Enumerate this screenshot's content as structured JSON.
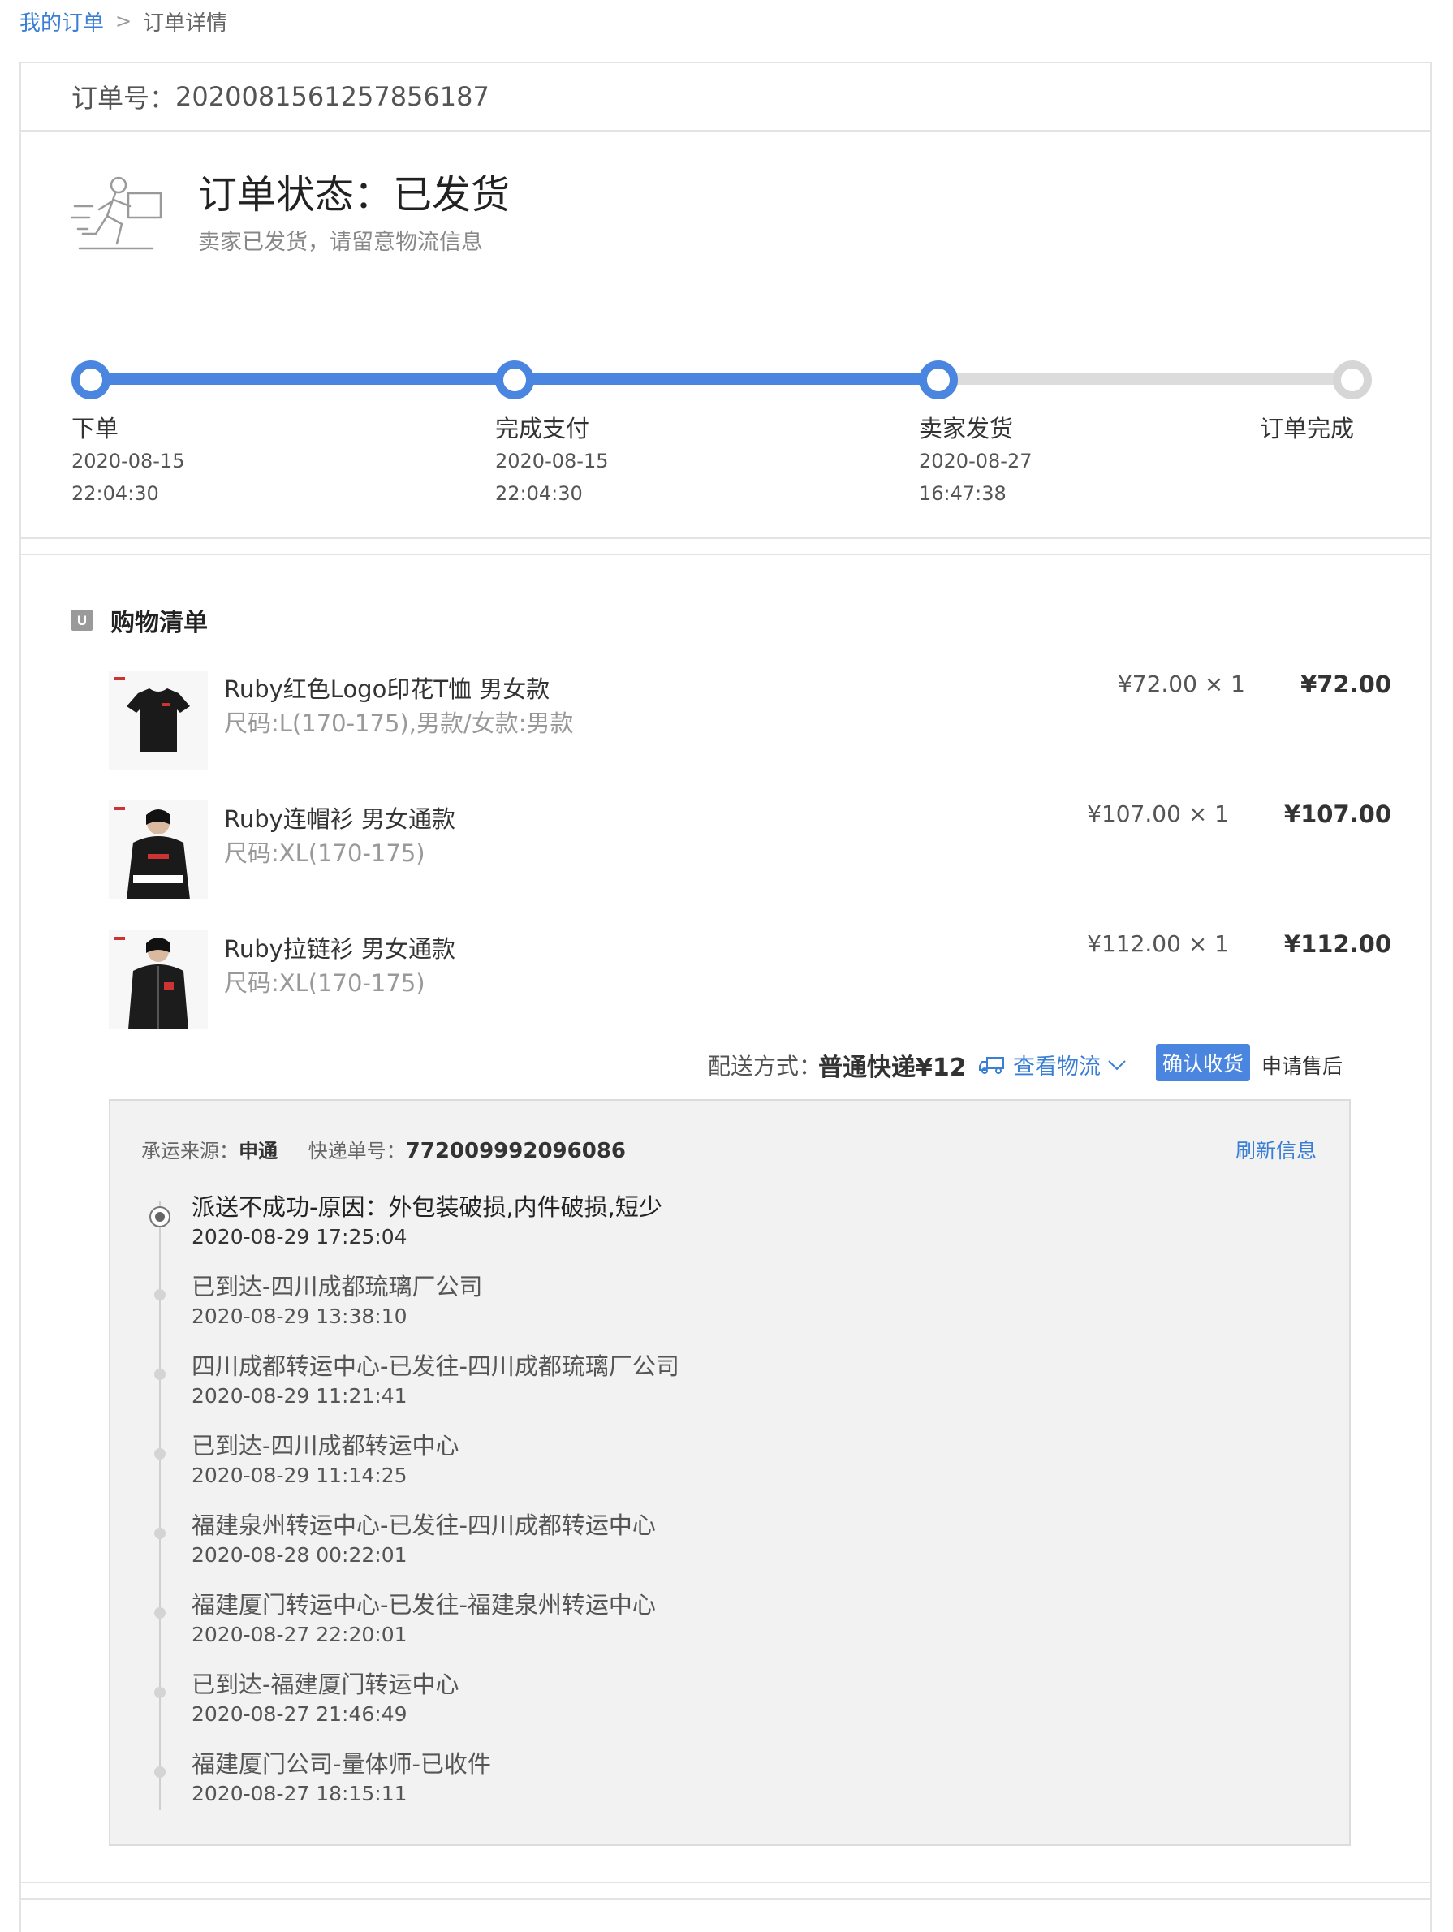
{
  "breadcrumb": {
    "link": "我的订单",
    "separator": ">",
    "current": "订单详情"
  },
  "order": {
    "number_label": "订单号：",
    "number": "2020081561257856187"
  },
  "status": {
    "title": "订单状态：已发货",
    "subtitle": "卖家已发货，请留意物流信息",
    "icon": "delivery-runner-icon"
  },
  "steps": [
    {
      "label": "下单",
      "date": "2020-08-15",
      "time": "22:04:30",
      "done": true
    },
    {
      "label": "完成支付",
      "date": "2020-08-15",
      "time": "22:04:30",
      "done": true
    },
    {
      "label": "卖家发货",
      "date": "2020-08-27",
      "time": "16:47:38",
      "done": true
    },
    {
      "label": "订单完成",
      "date": "",
      "time": "",
      "done": false
    }
  ],
  "cart": {
    "title": "购物清单",
    "icon_letter": "U",
    "items": [
      {
        "name": "Ruby红色Logo印花T恤 男女款",
        "spec": "尺码:L(170-175),男款/女款:男款",
        "unit": "¥72.00 × 1",
        "total": "¥72.00",
        "thumb": "tshirt-icon"
      },
      {
        "name": "Ruby连帽衫 男女通款",
        "spec": "尺码:XL(170-175)",
        "unit": "¥107.00 × 1",
        "total": "¥107.00",
        "thumb": "hoodie-icon"
      },
      {
        "name": "Ruby拉链衫 男女通款",
        "spec": "尺码:XL(170-175)",
        "unit": "¥112.00 × 1",
        "total": "¥112.00",
        "thumb": "zip-jacket-icon"
      }
    ]
  },
  "shipping": {
    "label": "配送方式：",
    "value": "普通快递¥12",
    "track_link": "查看物流",
    "confirm_button": "确认收货",
    "aftersale_link": "申请售后"
  },
  "logistics": {
    "carrier_label": "承运来源：",
    "carrier": "申通",
    "tracking_label": "快递单号：",
    "tracking_no": "772009992096086",
    "refresh": "刷新信息",
    "events": [
      {
        "text": "派送不成功-原因：外包装破损,内件破损,短少",
        "time": "2020-08-29 17:25:04"
      },
      {
        "text": "已到达-四川成都琉璃厂公司",
        "time": "2020-08-29 13:38:10"
      },
      {
        "text": "四川成都转运中心-已发往-四川成都琉璃厂公司",
        "time": "2020-08-29 11:21:41"
      },
      {
        "text": "已到达-四川成都转运中心",
        "time": "2020-08-29 11:14:25"
      },
      {
        "text": "福建泉州转运中心-已发往-四川成都转运中心",
        "time": "2020-08-28 00:22:01"
      },
      {
        "text": "福建厦门转运中心-已发往-福建泉州转运中心",
        "time": "2020-08-27 22:20:01"
      },
      {
        "text": "已到达-福建厦门转运中心",
        "time": "2020-08-27 21:46:49"
      },
      {
        "text": "福建厦门公司-量体师-已收件",
        "time": "2020-08-27 18:15:11"
      }
    ]
  },
  "colors": {
    "accent": "#4a86e0",
    "link": "#3a7fd5",
    "track_todo": "#dcdcdc"
  }
}
